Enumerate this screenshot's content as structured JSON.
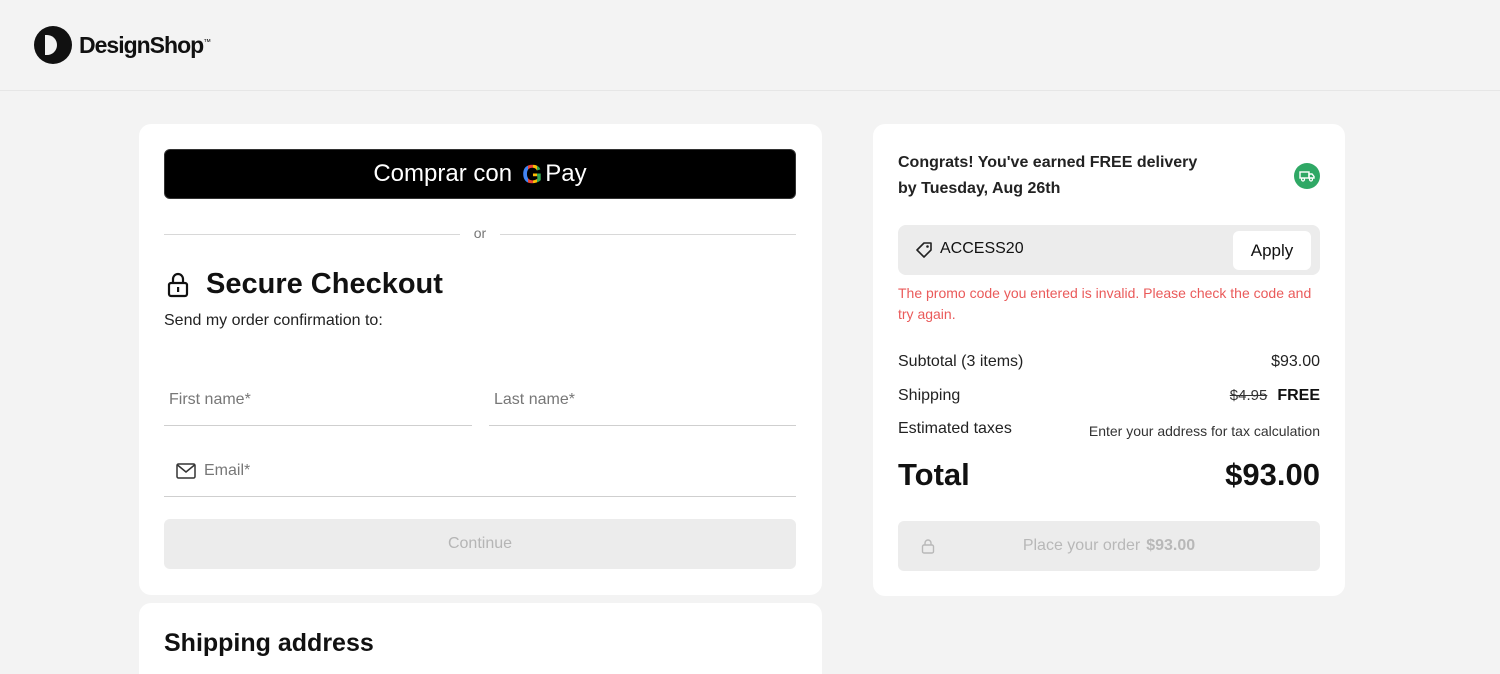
{
  "brand": {
    "name": "DesignShop",
    "trademark": "™"
  },
  "checkout": {
    "gpay_label": "Comprar con",
    "gpay_pay": "Pay",
    "or_text": "or",
    "title": "Secure Checkout",
    "send_confirmation": "Send my order confirmation to:",
    "first_name_placeholder": "First name*",
    "last_name_placeholder": "Last name*",
    "email_placeholder": "Email*",
    "continue_label": "Continue"
  },
  "shipping": {
    "title": "Shipping address"
  },
  "summary": {
    "congrats": "Congrats! You've earned FREE delivery by Tuesday, Aug 26th",
    "promo_code": "ACCESS20",
    "apply_label": "Apply",
    "promo_error": "The promo code you entered is invalid. Please check the code and try again.",
    "subtotal_label": "Subtotal (3 items)",
    "subtotal_value": "$93.00",
    "shipping_label": "Shipping",
    "shipping_old": "$4.95",
    "shipping_value": "FREE",
    "taxes_label": "Estimated taxes",
    "taxes_value": "Enter your address for tax calculation",
    "total_label": "Total",
    "total_value": "$93.00",
    "place_order_label": "Place your order",
    "place_order_amount": "$93.00"
  },
  "colors": {
    "accent_green": "#2fa865",
    "error_red": "#ea5a5a"
  }
}
